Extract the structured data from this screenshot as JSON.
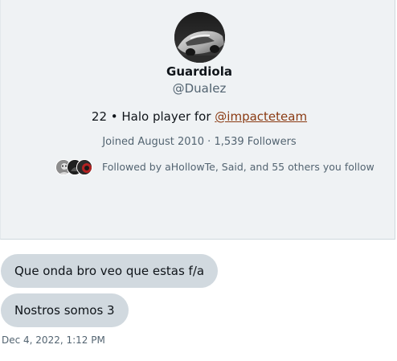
{
  "profile": {
    "name": "Guardiola",
    "handle": "@DuaIez",
    "bio_prefix": "22 • Halo player for ",
    "bio_link": "@impacteteam",
    "joined": "Joined August 2010 · 1,539 Followers",
    "followed_by": "Followed by aHollowTe, Said, and 55 others you follow"
  },
  "messages": [
    {
      "text": "Que onda bro veo que estas f/a"
    },
    {
      "text": "Nostros somos 3"
    }
  ],
  "timestamp": "Dec 4, 2022, 1:12 PM",
  "colors": {
    "card_bg": "#eff2f4",
    "bubble_bg": "#d1d9df",
    "link": "#8a3a12",
    "secondary_text": "#536471"
  }
}
